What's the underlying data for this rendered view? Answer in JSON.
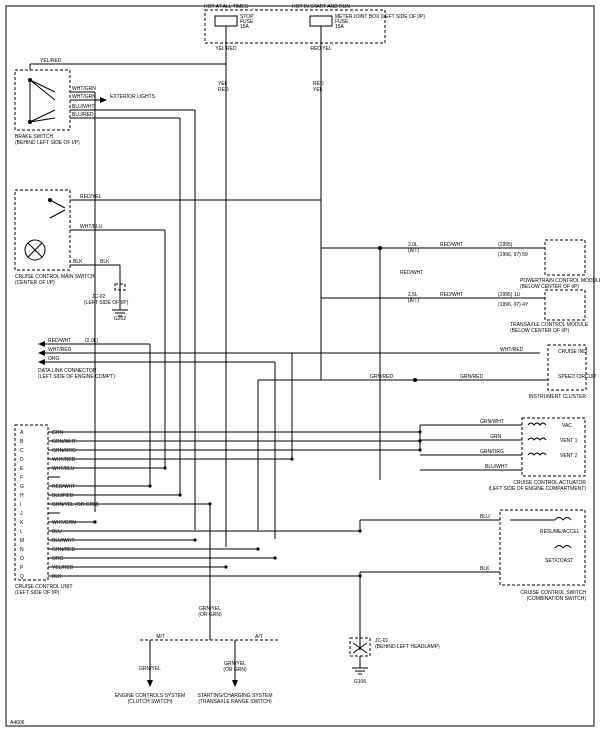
{
  "fuses": {
    "stop": {
      "top": "HOT AT ALL TIMES",
      "name": "STOP",
      "type": "FUSE",
      "amps": "15A"
    },
    "meter": {
      "top": "HOT IN START AND RUN",
      "name": "METER",
      "type": "FUSE",
      "amps": "15A"
    },
    "box": "JOINT BOX (LEFT SIDE OF I/P)"
  },
  "brake_switch": {
    "name": "BRAKE SWITCH",
    "loc": "(BEHIND LEFT SIDE OF I/P)",
    "w1": "YEL/RED",
    "w2": "WHT/GRN",
    "w2b": "WHT/GRN",
    "ext": "EXTERIOR LIGHTS",
    "w3": "BLU/WHT",
    "w4": "BLU/RED"
  },
  "main_switch": {
    "name": "CRUISE CONTROL MAIN SWITCH",
    "loc": "(CENTER OF I/P)",
    "w1": "RED/YEL",
    "w2": "WHT/BLU",
    "w3": "BLK",
    "w3b": "BLK",
    "jc": "JC-02",
    "jcloc": "(LEFT SIDE OF I/P)",
    "gnd": "G202"
  },
  "datalink": {
    "w1": "RED/WHT",
    "w1note": "(2.0L)",
    "w2": "WHT/RED",
    "w3": "ORG",
    "name": "DATA LINK CONNECTOR",
    "loc": "(LEFT SIDE OF ENGINE COMPT)"
  },
  "pcm": {
    "conn_a": "2.0L (A/T)",
    "w_a": "RED/WHT",
    "note_a1": "(1995)",
    "note_a2": "(1996, 97)   59",
    "name": "POWERTRAIN CONTROL MODULE",
    "loc": "(BELOW CENTER OF I/P)",
    "conn_b": "2.5L (A/T)",
    "w_b": "RED/WHT",
    "note_b": "(1995)   1U",
    "note_b2": "(1996, 97)   4Y",
    "name2": "TRANSAXLE CONTROL MODULE",
    "loc2": "(BELOW CENTER OF I/P)"
  },
  "cluster": {
    "w1": "WHT/RED",
    "sig1": "CRUISE IND",
    "w2": "GRN/RED",
    "w2b": "GRN/RED",
    "sig2": "SPEED CIRCUIT",
    "name": "INSTRUMENT CLUSTER"
  },
  "actuator": {
    "name": "CRUISE CONTROL ACTUATOR",
    "loc": "(LEFT SIDE OF ENGINE COMPARTMENT)",
    "l1": "GRN/WHT",
    "s1": "VAC",
    "l2": "GRN",
    "s2": "VENT 1",
    "l3": "GRN/ORG",
    "s3": "VENT 2",
    "l4": "BLU/WHT"
  },
  "cc_switch": {
    "name": "CRUISE CONTROL SWITCH",
    "sub": "(COMBINATION SWITCH)",
    "w": "BLU",
    "b1": "RESUME/ACCEL",
    "b2": "SET/COAST",
    "wb": "BLK"
  },
  "ccu": {
    "name": "CRUISE CONTROL UNIT",
    "loc": "(LEFT SIDE OF I/P)",
    "pins": [
      {
        "pin": "A",
        "color": "GRN"
      },
      {
        "pin": "B",
        "color": "GRN/WHT"
      },
      {
        "pin": "C",
        "color": "GRN/ORG"
      },
      {
        "pin": "D",
        "color": "WHT/RED"
      },
      {
        "pin": "E",
        "color": "WHT/BLU"
      },
      {
        "pin": "F",
        "color": ""
      },
      {
        "pin": "G",
        "color": "RED/WHT"
      },
      {
        "pin": "H",
        "color": "BLU/RED"
      },
      {
        "pin": "I",
        "color": "GRN/YEL (OR GRN)"
      },
      {
        "pin": "J",
        "color": ""
      },
      {
        "pin": "K",
        "color": "WHT/GRN"
      },
      {
        "pin": "L",
        "color": "BLU"
      },
      {
        "pin": "M",
        "color": "BLU/WHT"
      },
      {
        "pin": "N",
        "color": "GRN/RED"
      },
      {
        "pin": "O",
        "color": "ORG"
      },
      {
        "pin": "P",
        "color": "YEL/RED"
      },
      {
        "pin": "Q",
        "color": "BLK"
      }
    ]
  },
  "bottom": {
    "w1": "GRN/YEL",
    "w1note": "(OR GRN)",
    "mt": "M/T",
    "at": "A/T",
    "wL": "GRN/YEL",
    "wR": "GRN/YEL",
    "wRnote": "(OR GRN)",
    "eng": "ENGINE CONTROLS SYSTEM",
    "eng2": "(CLUTCH SWITCH)",
    "start": "STARTING/CHARGING SYSTEM",
    "start2": "(TRANSAXLE RANGE SWITCH)",
    "jc": "JC-01",
    "jcloc": "(BEHIND LEFT HEADLAMP)",
    "gnd": "G106"
  },
  "top_colors": {
    "left": "YEL RED",
    "right": "RED YEL"
  },
  "fig": "A4606"
}
